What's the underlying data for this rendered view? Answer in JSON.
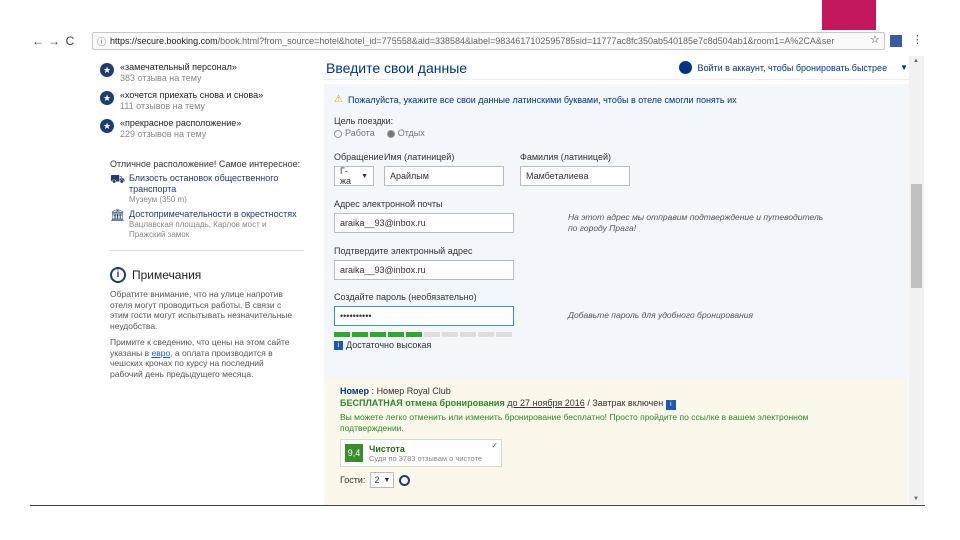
{
  "browser": {
    "url_host": "https://secure.booking.com",
    "url_rest": "/book.html?from_source=hotel&hotel_id=775558&aid=338584&label=9834617102595785sid=11777ac8fc350ab540185e7c8d504ab1&room1=A%2CA&ser"
  },
  "sidebar": {
    "reviews": [
      {
        "title": "«замечательный персонал»",
        "count": "383 отзыва на тему"
      },
      {
        "title": "«хочется приехать снова и снова»",
        "count": "111 отзывов на тему"
      },
      {
        "title": "«прекрасное расположение»",
        "count": "229 отзывов на тему"
      }
    ],
    "location_title": "Отличное расположение! Самое интересное:",
    "locations": [
      {
        "icon": "bus-icon",
        "title": "Близость остановок общественного транспорта",
        "sub": "Музеум (350 m)"
      },
      {
        "icon": "landmark-icon",
        "title": "Достопримечательности в окрестностях",
        "sub": "Вацлавская площадь, Карлов мост и Пражский замок"
      }
    ],
    "notes_title": "Примечания",
    "note1": "Обратите внимание, что на улице напротив отеля могут проводиться работы. В связи с этим гости могут испытывать незначительные неудобства.",
    "note2_a": "Примите к сведению, что цены на этом сайте указаны в ",
    "note2_link": "евро",
    "note2_b": ", а оплата производится в чешских кронах по курсу на последний рабочий день предыдущего месяца."
  },
  "main": {
    "title": "Введите свои данные",
    "login": "Войти в аккаунт, чтобы бронировать быстрее",
    "warning": "Пожалуйста, укажите все свои данные латинскими буквами, чтобы в отеле смогли понять их",
    "purpose_label": "Цель поездки:",
    "purpose_work": "Работа",
    "purpose_leisure": "Отдых",
    "salutation_label": "Обращение",
    "salutation_value": "Г-жа",
    "firstname_label": "Имя (латиницей)",
    "firstname_value": "Арайлым",
    "lastname_label": "Фамилия (латиницей)",
    "lastname_value": "Мамбеталиева",
    "email_label": "Адрес электронной почты",
    "email_value": "araika__93@inbox.ru",
    "email_hint": "На этот адрес мы отправим подтверждение и путеводитель по городу Прага!",
    "confirm_label": "Подтвердите электронный адрес",
    "confirm_value": "araika__93@inbox.ru",
    "password_label": "Создайте пароль (необязательно)",
    "password_value": "••••••••••",
    "password_hint": "Добавьте пароль для удобного бронирования",
    "strength": "Достаточно высокая",
    "strength_fraction": 0.5
  },
  "room": {
    "label": "Номер",
    "name": "Номер Royal Club",
    "free_cancel": "БЕСПЛАТНАЯ отмена бронирования",
    "free_until": "до 27 ноября 2016",
    "breakfast": "Завтрак включен",
    "free_text": "Вы можете легко отменить или изменить бронирование бесплатно! Просто пройдите по ссылке в вашем электронном подтверждении.",
    "score": "9,4",
    "clean_title": "Чистота",
    "clean_sub": "Судя по 3783 отзывам о чистоте",
    "guests_label": "Гости:",
    "guests_value": "2"
  }
}
